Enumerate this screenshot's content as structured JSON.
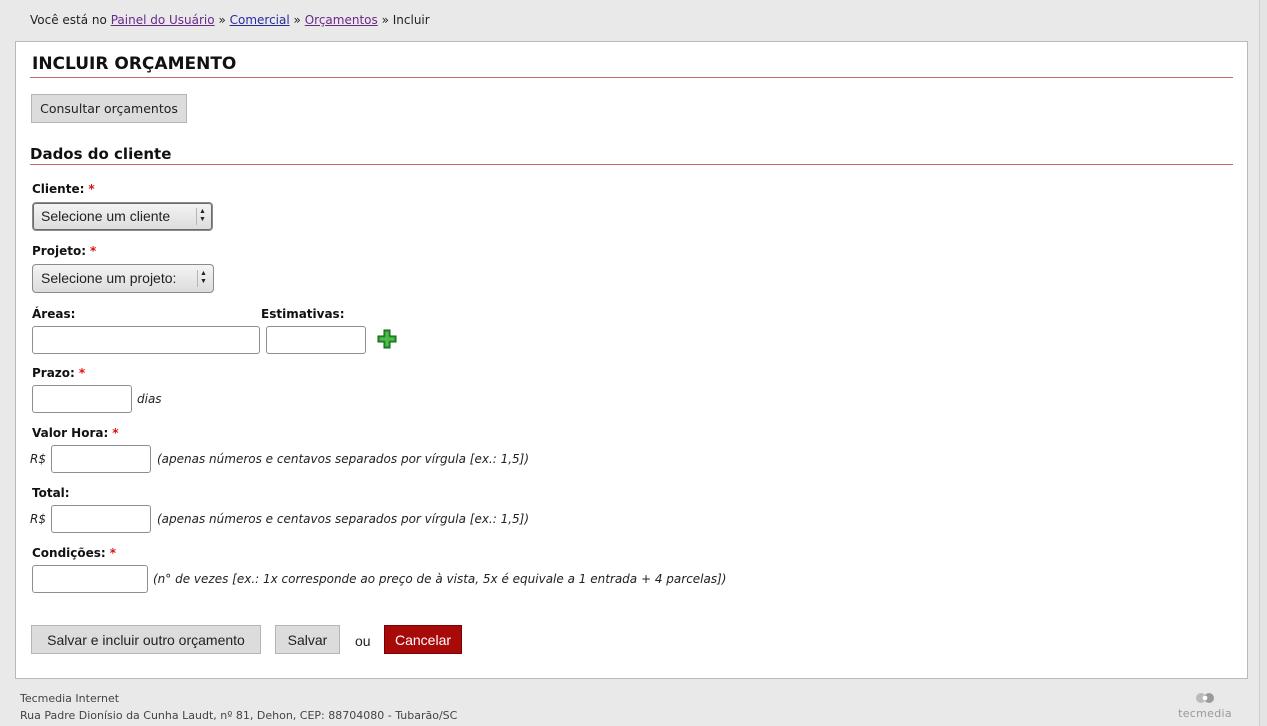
{
  "breadcrumb": {
    "prefix": "Você está no",
    "items": [
      "Painel do Usuário",
      "Comercial",
      "Orçamentos"
    ],
    "separator": "»",
    "current": "Incluir"
  },
  "page": {
    "title": "INCLUIR ORÇAMENTO",
    "consult_button": "Consultar orçamentos"
  },
  "section": {
    "title": "Dados do cliente"
  },
  "form": {
    "required_mark": "*",
    "cliente": {
      "label": "Cliente:",
      "selected": "Selecione um cliente"
    },
    "projeto": {
      "label": "Projeto:",
      "selected": "Selecione um projeto:"
    },
    "areas": {
      "label": "Áreas:",
      "value": ""
    },
    "estimativas": {
      "label": "Estimativas:",
      "value": ""
    },
    "prazo": {
      "label": "Prazo:",
      "value": "",
      "unit": "dias"
    },
    "valor_hora": {
      "label": "Valor Hora:",
      "currency": "R$",
      "value": "",
      "hint": "(apenas números e centavos separados por vírgula [ex.: 1,5])"
    },
    "total": {
      "label": "Total:",
      "currency": "R$",
      "value": "",
      "hint": "(apenas números e centavos separados por vírgula [ex.: 1,5])"
    },
    "condicoes": {
      "label": "Condições:",
      "value": "",
      "hint": "(n° de vezes [ex.: 1x corresponde ao preço de à vista, 5x é equivale a 1 entrada + 4 parcelas])"
    }
  },
  "actions": {
    "save_and_new": "Salvar e incluir outro orçamento",
    "save": "Salvar",
    "or": "ou",
    "cancel": "Cancelar"
  },
  "footer": {
    "company": "Tecmedia Internet",
    "address": "Rua Padre Dionísio da Cunha Laudt, nº 81, Dehon, CEP: 88704080 - Tubarão/SC",
    "logo_text": "tecmedia"
  },
  "colors": {
    "accent_rule": "#c46a6a",
    "required": "#dd1111",
    "cancel_bg": "#a80a0a",
    "add_icon": "#2a9a2a"
  },
  "icons": {
    "add": "plus-icon",
    "select_arrow": "updown-arrow-icon"
  }
}
